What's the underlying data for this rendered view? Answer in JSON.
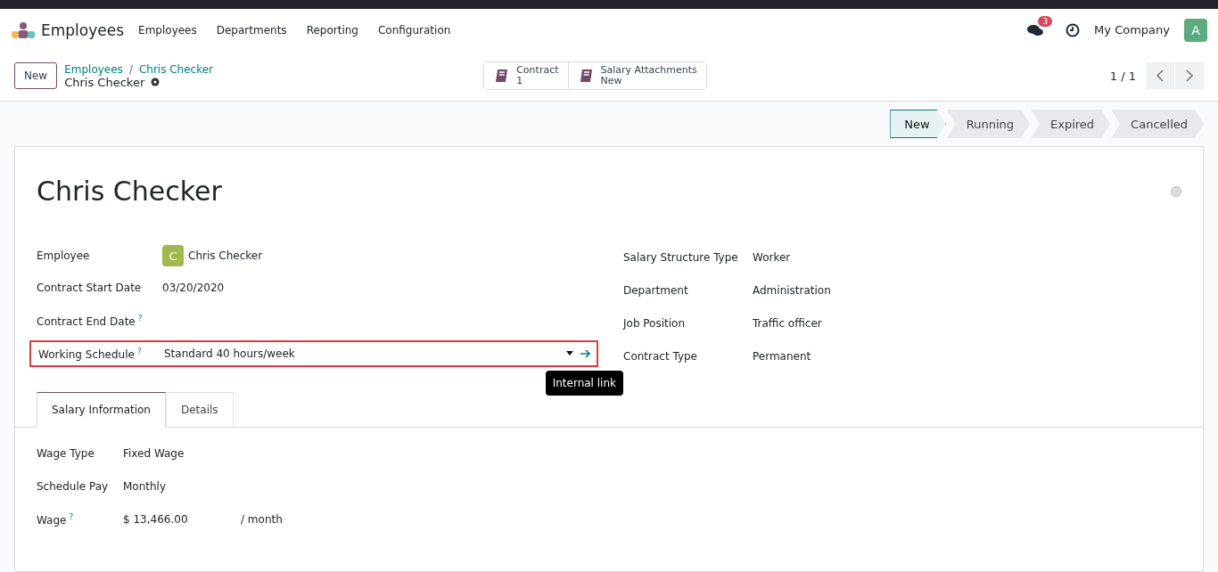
{
  "navbar": {
    "app_name": "Employees",
    "menu": [
      "Employees",
      "Departments",
      "Reporting",
      "Configuration"
    ],
    "messages_badge": "3",
    "company": "My Company",
    "avatar_letter": "A"
  },
  "control_panel": {
    "new_button": "New",
    "breadcrumb": "Employees",
    "breadcrumb_sep": "/",
    "breadcrumb_current": "Chris Checker",
    "record_title": "Chris Checker",
    "smart_buttons": [
      {
        "label": "Contract",
        "value": "1"
      },
      {
        "label": "Salary Attachments",
        "value": "New"
      }
    ],
    "pager": "1 / 1"
  },
  "status_bar": [
    {
      "label": "New",
      "selected": true
    },
    {
      "label": "Running",
      "selected": false
    },
    {
      "label": "Expired",
      "selected": false
    },
    {
      "label": "Cancelled",
      "selected": false
    }
  ],
  "form": {
    "title": "Chris Checker",
    "left_fields": [
      {
        "kind": "avatar",
        "label": "Employee",
        "value": "Chris Checker",
        "avatar": "C"
      },
      {
        "kind": "text",
        "label": "Contract Start Date",
        "value": "03/20/2020"
      },
      {
        "kind": "text",
        "label": "Contract End Date",
        "help": "?"
      },
      {
        "kind": "select",
        "label": "Working Schedule",
        "help": "?",
        "value": "Standard 40 hours/week",
        "highlighted": true,
        "tooltip": "Internal link"
      }
    ],
    "right_fields": [
      {
        "label": "Salary Structure Type",
        "value": "Worker"
      },
      {
        "label": "Department",
        "value": "Administration"
      },
      {
        "label": "Job Position",
        "value": "Traffic officer"
      },
      {
        "label": "Contract Type",
        "value": "Permanent"
      }
    ],
    "tabs": [
      {
        "label": "Salary Information",
        "selected": true
      },
      {
        "label": "Details",
        "selected": false
      }
    ],
    "salary_fields": [
      {
        "label": "Wage Type",
        "value": "Fixed Wage"
      },
      {
        "label": "Schedule Pay",
        "value": "Monthly"
      },
      {
        "label": "Wage",
        "help": "?",
        "value": "$ 13,466.00",
        "suffix": "/ month"
      }
    ]
  }
}
